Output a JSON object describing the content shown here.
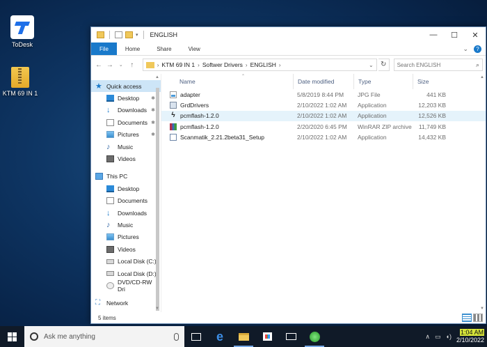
{
  "desktop": {
    "icons": [
      {
        "label": "ToDesk"
      },
      {
        "label": "KTM 69 IN 1"
      }
    ]
  },
  "window": {
    "title": "ENGLISH",
    "controls": {
      "minimize": "—",
      "maximize": "☐",
      "close": "✕"
    },
    "ribbon_tabs": [
      "File",
      "Home",
      "Share",
      "View"
    ],
    "ribbon_expand": "⌄",
    "help": "?",
    "address": {
      "crumbs": [
        "KTM 69 IN 1",
        "Softwer Drivers",
        "ENGLISH"
      ],
      "refresh": "↻"
    },
    "search": {
      "placeholder": "Search ENGLISH",
      "icon": "search-icon"
    },
    "nav": {
      "quick_access": {
        "label": "Quick access",
        "items": [
          {
            "label": "Desktop",
            "icon": "desktop-icon",
            "pinned": true
          },
          {
            "label": "Downloads",
            "icon": "download-icon",
            "pinned": true
          },
          {
            "label": "Documents",
            "icon": "documents-icon",
            "pinned": true
          },
          {
            "label": "Pictures",
            "icon": "pictures-icon",
            "pinned": true
          },
          {
            "label": "Music",
            "icon": "music-icon",
            "pinned": false
          },
          {
            "label": "Videos",
            "icon": "videos-icon",
            "pinned": false
          }
        ]
      },
      "this_pc": {
        "label": "This PC",
        "items": [
          {
            "label": "Desktop",
            "icon": "desktop-icon"
          },
          {
            "label": "Documents",
            "icon": "documents-icon"
          },
          {
            "label": "Downloads",
            "icon": "download-icon"
          },
          {
            "label": "Music",
            "icon": "music-icon"
          },
          {
            "label": "Pictures",
            "icon": "pictures-icon"
          },
          {
            "label": "Videos",
            "icon": "videos-icon"
          },
          {
            "label": "Local Disk (C:)",
            "icon": "disk-icon"
          },
          {
            "label": "Local Disk (D:)",
            "icon": "disk-icon"
          },
          {
            "label": "DVD/CD-RW Dri",
            "icon": "dvd-icon"
          }
        ]
      },
      "network": {
        "label": "Network"
      }
    },
    "columns": {
      "name": "Name",
      "date": "Date modified",
      "type": "Type",
      "size": "Size"
    },
    "files": [
      {
        "name": "adapter",
        "date": "5/8/2019 8:44 PM",
        "type": "JPG File",
        "size": "441 KB",
        "icon": "jpg-file-icon"
      },
      {
        "name": "GrdDrivers",
        "date": "2/10/2022 1:02 AM",
        "type": "Application",
        "size": "12,203 KB",
        "icon": "application-icon"
      },
      {
        "name": "pcmflash-1.2.0",
        "date": "2/10/2022 1:02 AM",
        "type": "Application",
        "size": "12,526 KB",
        "icon": "bolt-app-icon"
      },
      {
        "name": "pcmflash-1.2.0",
        "date": "2/20/2020 6:45 PM",
        "type": "WinRAR ZIP archive",
        "size": "11,749 KB",
        "icon": "winrar-icon"
      },
      {
        "name": "Scanmatik_2.21.2beta31_Setup",
        "date": "2/10/2022 1:02 AM",
        "type": "Application",
        "size": "14,432 KB",
        "icon": "setup-icon"
      }
    ],
    "status": {
      "item_count": "5 items"
    }
  },
  "taskbar": {
    "search_placeholder": "Ask me anything",
    "clock": {
      "time": "1:04 AM",
      "date": "2/10/2022"
    }
  }
}
